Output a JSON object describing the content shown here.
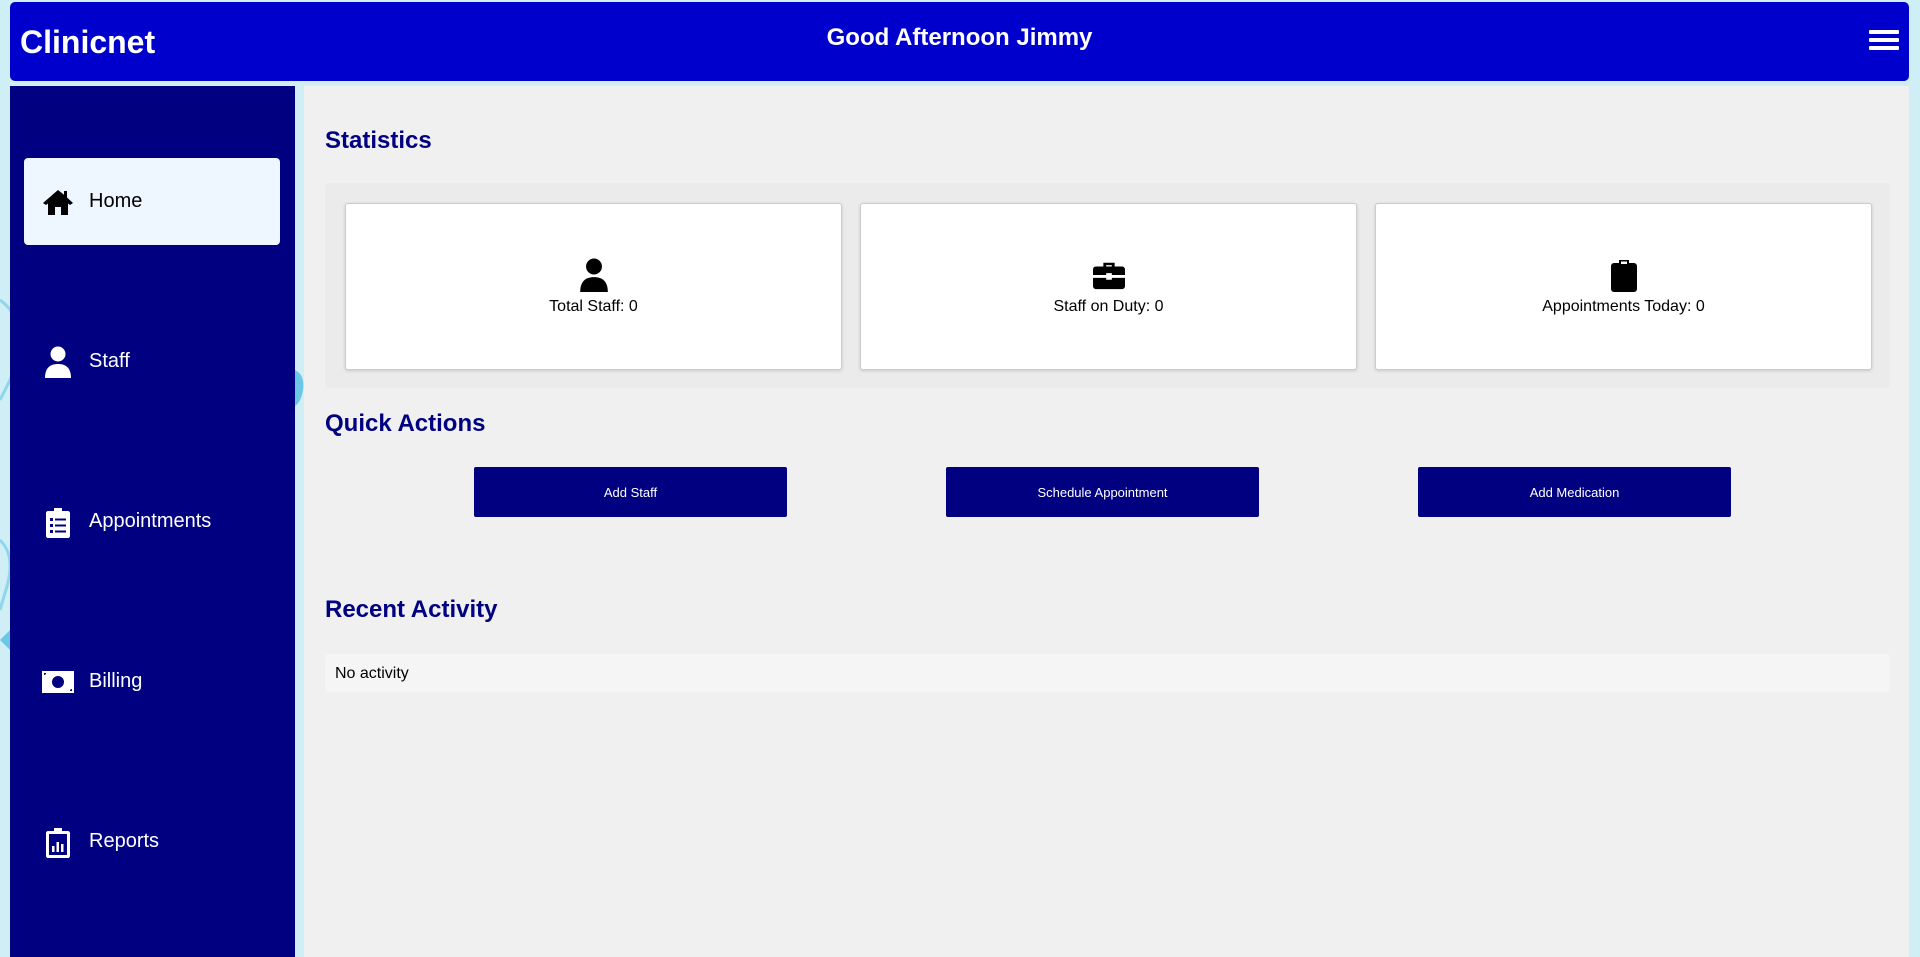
{
  "header": {
    "brand": "Clinicnet",
    "greeting": "Good Afternoon Jimmy",
    "menu_icon": "hamburger-menu-icon",
    "color": "#0000cd"
  },
  "sidebar": {
    "color": "#000080",
    "items": [
      {
        "label": "Home",
        "icon": "home-icon",
        "active": true
      },
      {
        "label": "Staff",
        "icon": "user-icon",
        "active": false
      },
      {
        "label": "Appointments",
        "icon": "clipboard-list-icon",
        "active": false
      },
      {
        "label": "Billing",
        "icon": "money-bill-icon",
        "active": false
      },
      {
        "label": "Reports",
        "icon": "report-clipboard-icon",
        "active": false
      }
    ]
  },
  "main": {
    "statistics_title": "Statistics",
    "stats": [
      {
        "label": "Total Staff: 0",
        "icon": "user-icon"
      },
      {
        "label": "Staff on Duty: 0",
        "icon": "briefcase-icon"
      },
      {
        "label": "Appointments Today: 0",
        "icon": "clipboard-icon"
      }
    ],
    "quick_actions_title": "Quick Actions",
    "quick_actions": [
      {
        "label": "Add Staff"
      },
      {
        "label": "Schedule Appointment"
      },
      {
        "label": "Add Medication"
      }
    ],
    "recent_activity_title": "Recent Activity",
    "recent_activity_text": "No activity"
  }
}
